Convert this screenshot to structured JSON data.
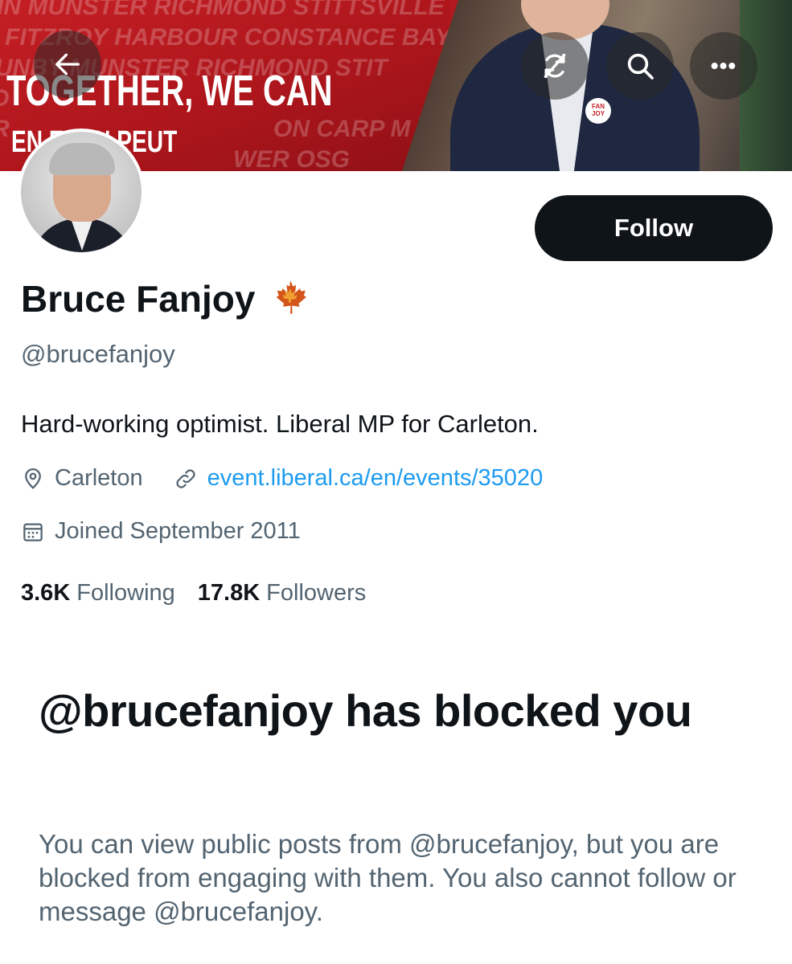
{
  "banner": {
    "background_lines": [
      "IN MUNSTER RICHMOND STITTSVILLE",
      "FITZROY HARBOUR CONSTANCE BAY",
      "UNBY MUNSTER RICHMOND STIT",
      "D",
      "R",
      "ON CARP M",
      "WER OSG"
    ],
    "slogan_line1": "TOGETHER, WE CAN",
    "slogan_line2": "EN    E, ON PEUT",
    "pin_text": "FAN JOY"
  },
  "toolbar": {
    "back_icon": "arrow-left-icon",
    "refresh_icon": "refresh-off-icon",
    "search_icon": "search-icon",
    "more_icon": "more-horizontal-icon",
    "more_label": "•••"
  },
  "profile": {
    "follow_label": "Follow",
    "name": "Bruce Fanjoy",
    "name_emoji_icon": "maple-leaf-icon",
    "handle": "@brucefanjoy",
    "bio": "Hard-working optimist. Liberal MP for Carleton.",
    "location": "Carleton",
    "website": "event.liberal.ca/en/events/35020",
    "joined": "Joined September 2011",
    "following_count": "3.6K",
    "following_label": "Following",
    "followers_count": "17.8K",
    "followers_label": "Followers"
  },
  "blocked": {
    "title": "@brucefanjoy has blocked you",
    "message": "You can view public posts from @brucefanjoy, but you are blocked from engaging with them. You also cannot follow or message @brucefanjoy."
  },
  "colors": {
    "accent": "#1d9bf0",
    "banner_red": "#c41f24",
    "text_primary": "#0f1419",
    "text_secondary": "#536471"
  }
}
